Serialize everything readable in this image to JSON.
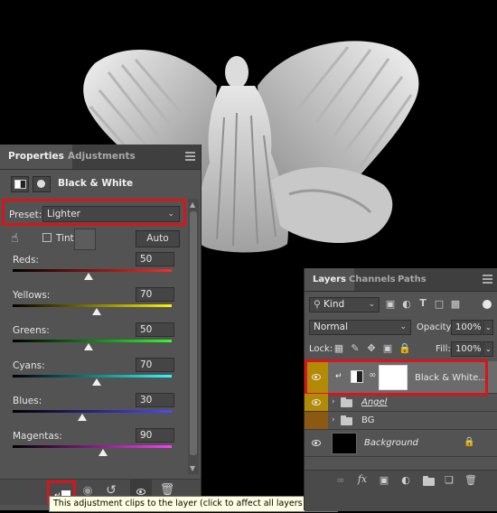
{
  "properties": {
    "tabs": [
      {
        "label": "Properties"
      },
      {
        "label": "Adjustments"
      }
    ],
    "title": "Black & White",
    "preset_label": "Preset:",
    "preset_value": "Lighter",
    "tint_label": "Tint",
    "auto_label": "Auto",
    "sliders": [
      {
        "label": "Reds:",
        "value": "50",
        "fraction": 0.48
      },
      {
        "label": "Yellows:",
        "value": "70",
        "fraction": 0.53
      },
      {
        "label": "Greens:",
        "value": "50",
        "fraction": 0.48
      },
      {
        "label": "Cyans:",
        "value": "70",
        "fraction": 0.53
      },
      {
        "label": "Blues:",
        "value": "30",
        "fraction": 0.44
      },
      {
        "label": "Magentas:",
        "value": "90",
        "fraction": 0.57
      }
    ]
  },
  "tooltip": "This adjustment clips to the layer (click to affect all layers below)",
  "layers_panel": {
    "tabs": [
      {
        "label": "Layers"
      },
      {
        "label": "Channels"
      },
      {
        "label": "Paths"
      }
    ],
    "kind_label": "Kind",
    "blend_mode": "Normal",
    "opacity_label": "Opacity:",
    "opacity_value": "100%",
    "lock_label": "Lock:",
    "fill_label": "Fill:",
    "fill_value": "100%",
    "layers": [
      {
        "name": "Black & White..."
      },
      {
        "name": "Angel"
      },
      {
        "name": "BG"
      },
      {
        "name": "Background"
      }
    ]
  },
  "colors": {
    "highlight_red": "#d9141b",
    "eye_yellow": "#b38a06",
    "eye_brown": "#8a5a12"
  }
}
